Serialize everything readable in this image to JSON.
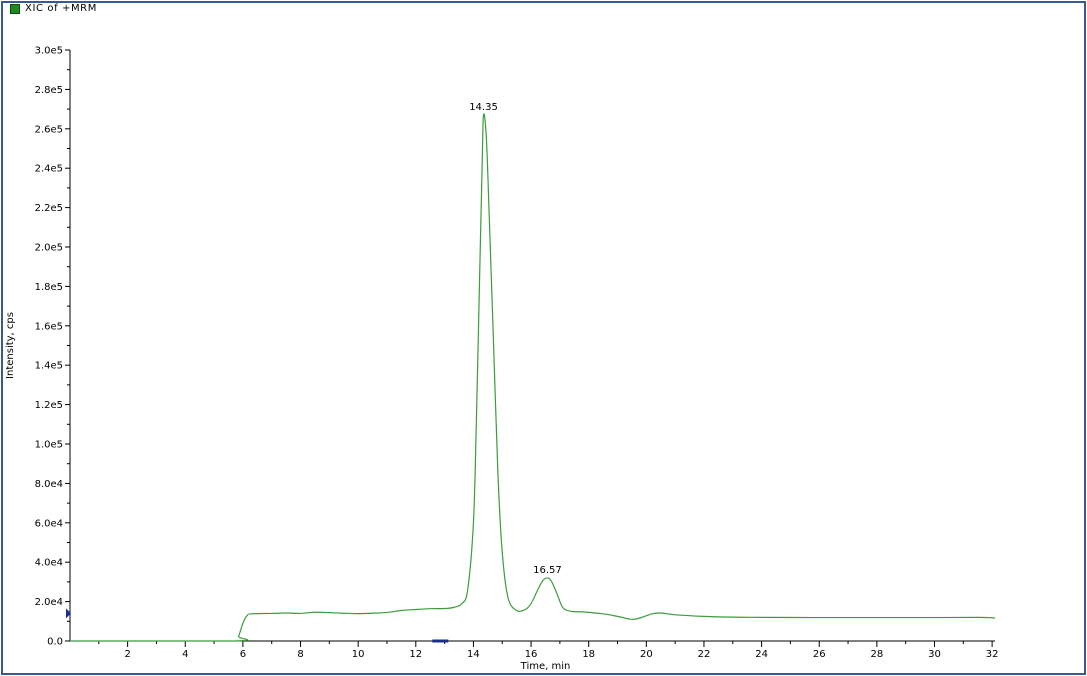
{
  "legend": {
    "label": "XIC of +MRM",
    "color": "#1f8a1f"
  },
  "chart_data": {
    "type": "line",
    "title": "",
    "xlabel": "Time, min",
    "ylabel": "Intensity, cps",
    "xlim": [
      0,
      32.1
    ],
    "ylim": [
      0,
      300000
    ],
    "x_ticks": [
      "2",
      "4",
      "6",
      "8",
      "10",
      "12",
      "14",
      "16",
      "18",
      "20",
      "22",
      "24",
      "26",
      "28",
      "30",
      "32"
    ],
    "y_ticks": [
      "0.0",
      "2.0e4",
      "4.0e4",
      "6.0e4",
      "8.0e4",
      "1.0e5",
      "1.2e5",
      "1.4e5",
      "1.6e5",
      "1.8e5",
      "2.0e5",
      "2.2e5",
      "2.4e5",
      "2.6e5",
      "2.8e5",
      "3.0e5"
    ],
    "grid": false,
    "line_color": "#3c9c3c",
    "annotations": [
      {
        "label": "14.35",
        "x": 14.35,
        "y": 267000
      },
      {
        "label": "16.57",
        "x": 16.57,
        "y": 32000
      }
    ],
    "series": [
      {
        "x": [
          0,
          5.7,
          5.85,
          6.0,
          6.15,
          6.3,
          7.0,
          7.5,
          8.0,
          8.5,
          9.0,
          9.5,
          10.0,
          10.5,
          11.0,
          11.5,
          12.0,
          12.5,
          13.0,
          13.3,
          13.6,
          13.8,
          14.0,
          14.1,
          14.2,
          14.3,
          14.35,
          14.45,
          14.55,
          14.7,
          14.85,
          15.0,
          15.2,
          15.5,
          15.8,
          16.0,
          16.2,
          16.4,
          16.57,
          16.7,
          16.9,
          17.1,
          17.4,
          17.8,
          18.5,
          19.0,
          19.5,
          19.8,
          20.2,
          20.5,
          21.0,
          22.0,
          23.0,
          24.0,
          26.0,
          28.0,
          30.0,
          31.5,
          32.0,
          32.1
        ],
        "y": [
          0,
          0,
          2500,
          9000,
          13000,
          13800,
          14000,
          14200,
          14000,
          14600,
          14400,
          14100,
          13900,
          14100,
          14500,
          15500,
          16000,
          16400,
          16500,
          17000,
          19000,
          26000,
          60000,
          110000,
          175000,
          240000,
          267000,
          255000,
          215000,
          150000,
          85000,
          45000,
          22000,
          15500,
          16000,
          19000,
          25000,
          30500,
          32000,
          30500,
          24000,
          17000,
          15000,
          14800,
          13800,
          12500,
          11000,
          11800,
          13800,
          14200,
          13300,
          12500,
          12100,
          12000,
          11900,
          11900,
          11900,
          12000,
          11800,
          11500
        ]
      }
    ]
  }
}
